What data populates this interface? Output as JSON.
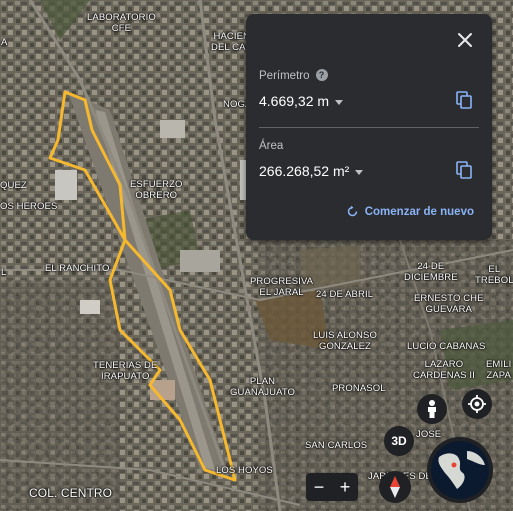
{
  "map": {
    "place_labels": [
      {
        "id": "laboratorio-cfe",
        "text": "LABORATORIO\nCFE"
      },
      {
        "id": "hacienda",
        "text": "HACIEN\nDEL CAR"
      },
      {
        "id": "noga",
        "text": "NOGA"
      },
      {
        "id": "esfuerzo-obrero",
        "text": "ESFUERZO\nOBRERO"
      },
      {
        "id": "quez",
        "text": "QUEZ"
      },
      {
        "id": "los-heroes",
        "text": "OS HEROES"
      },
      {
        "id": "el-ranchito",
        "text": "EL RANCHITO"
      },
      {
        "id": "progresiva",
        "text": "PROGRESIVA\nEL JARAL"
      },
      {
        "id": "24-abril",
        "text": "24 DE ABRIL"
      },
      {
        "id": "24-diciembre",
        "text": "24 DE\nDICIEMBRE"
      },
      {
        "id": "el-trebol",
        "text": "EL TREBOL"
      },
      {
        "id": "ernesto",
        "text": "ERNESTO CHE\nGUEVARA"
      },
      {
        "id": "luis-alonso",
        "text": "LUIS ALONSO\nGONZALEZ"
      },
      {
        "id": "lucio",
        "text": "LUCIO CABANAS"
      },
      {
        "id": "tenerias",
        "text": "TENERIAS DE\nIRAPUATO"
      },
      {
        "id": "plan-guanajuato",
        "text": "PLAN\nGUANAJUATO"
      },
      {
        "id": "pronasol",
        "text": "PRONASOL"
      },
      {
        "id": "lazaro",
        "text": "LAZARO\nCARDENAS II"
      },
      {
        "id": "emili",
        "text": "EMILI\nZAPA"
      },
      {
        "id": "jose",
        "text": "JOSE"
      },
      {
        "id": "san-carlos",
        "text": "SAN CARLOS"
      },
      {
        "id": "los-hoyos",
        "text": "LOS HOYOS"
      },
      {
        "id": "jardines",
        "text": "JARDINES DE"
      },
      {
        "id": "col-centro",
        "text": "COL. CENTRO"
      },
      {
        "id": "edge-a",
        "text": "A"
      },
      {
        "id": "edge-l",
        "text": "L"
      }
    ],
    "polygon_color": "#f5b82e"
  },
  "panel": {
    "perimeter_label": "Perímetro",
    "perimeter_value": "4.669,32 m",
    "area_label": "Área",
    "area_value": "266.268,52 m²",
    "restart_label": "Comenzar de nuevo",
    "accent_color": "#8ab4f8",
    "icons": [
      "close-icon",
      "help-icon",
      "copy-icon",
      "refresh-icon"
    ]
  },
  "controls": {
    "btn_3d_label": "3D",
    "zoom_out_label": "−",
    "zoom_in_label": "+",
    "icons": [
      "pegman-icon",
      "my-location-icon",
      "compass-icon",
      "globe-icon"
    ]
  }
}
